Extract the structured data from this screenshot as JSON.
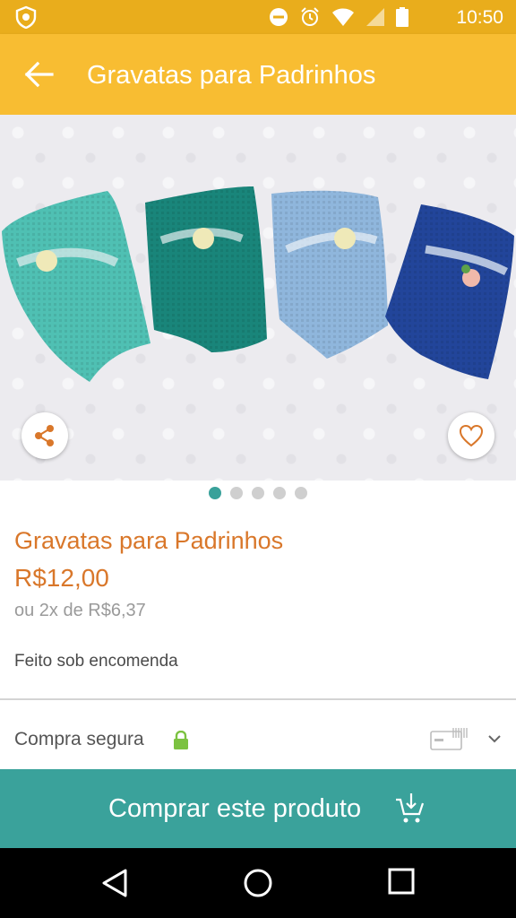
{
  "status_bar": {
    "time": "10:50",
    "icons": [
      "app-notification-icon",
      "do-not-disturb-icon",
      "alarm-icon",
      "wifi-icon",
      "cell-signal-icon",
      "battery-icon"
    ]
  },
  "app_bar": {
    "title": "Gravatas para Padrinhos",
    "back_icon": "arrow-back-icon",
    "color": "#f8bd32"
  },
  "gallery": {
    "current_index": 1,
    "total": 5,
    "share_icon": "share-icon",
    "favorite_icon": "heart-outline-icon"
  },
  "product": {
    "title": "Gravatas para Padrinhos",
    "price": "R$12,00",
    "installments": "ou 2x de R$6,37",
    "availability": "Feito sob encomenda"
  },
  "secure_purchase": {
    "label": "Compra segura",
    "lock_icon": "lock-icon",
    "card_icon": "credit-card-icon",
    "expand_icon": "chevron-down-icon"
  },
  "buy_button": {
    "label": "Comprar este produto",
    "icon": "add-to-cart-icon",
    "color": "#3aa29b"
  },
  "nav_bar": {
    "icons": [
      "back-triangle-icon",
      "home-circle-icon",
      "recents-square-icon"
    ]
  },
  "colors": {
    "accent": "#d9772a",
    "teal": "#3aa29b",
    "brand_yellow": "#f8bd32"
  }
}
